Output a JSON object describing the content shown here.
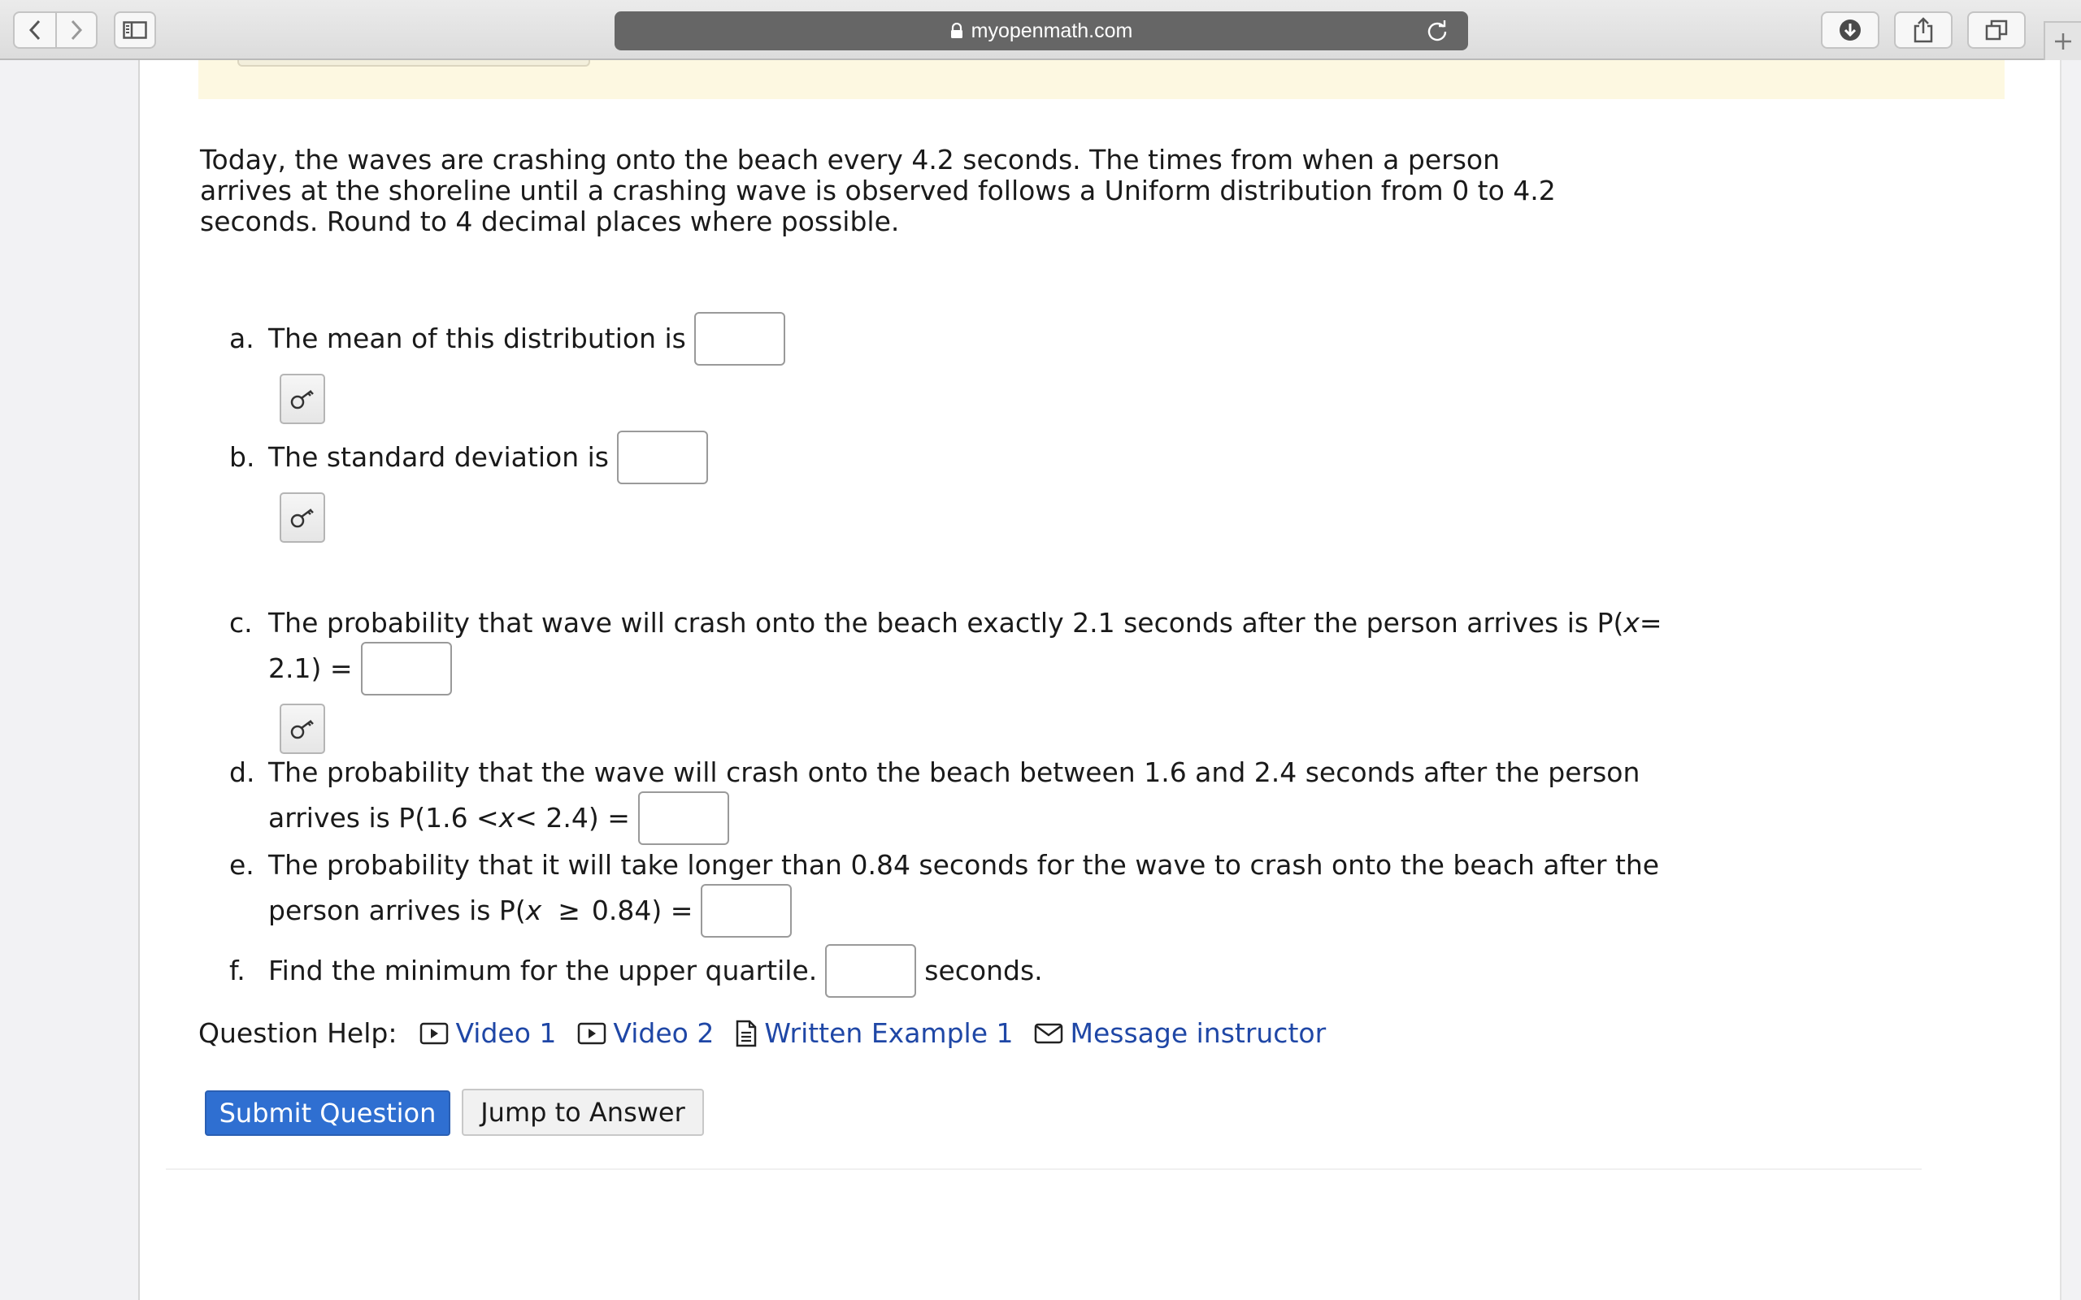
{
  "browser": {
    "url": "myopenmath.com"
  },
  "prompt": "Today, the waves are crashing onto the beach every 4.2 seconds. The times from when a person arrives at the shoreline until a crashing wave is observed follows a Uniform distribution from 0 to 4.2 seconds. Round to 4 decimal places where possible.",
  "questions": {
    "a": {
      "letter": "a.",
      "text": "The mean of this distribution is"
    },
    "b": {
      "letter": "b.",
      "text": "The standard deviation is"
    },
    "c": {
      "letter": "c.",
      "line1_pre": "The probability that wave will crash onto the beach exactly 2.1 seconds after the person arrives is P(",
      "var": "x",
      "line1_post": " =",
      "line2": "2.1) ="
    },
    "d": {
      "letter": "d.",
      "line1": "The probability that the wave will crash onto the beach between 1.6 and 2.4 seconds after the person",
      "line2_pre": "arrives is P(1.6 < ",
      "var": "x",
      "line2_post": " < 2.4) ="
    },
    "e": {
      "letter": "e.",
      "line1": "The probability that it will take longer than 0.84 seconds for the wave to crash onto the beach after the",
      "line2_pre": "person arrives is P(",
      "var": "x",
      "symbol": "≥",
      "line2_post": "0.84) ="
    },
    "f": {
      "letter": "f.",
      "text": "Find the minimum for the upper quartile.",
      "suffix": "seconds."
    }
  },
  "help": {
    "label": "Question Help:",
    "links": [
      {
        "label": "Video 1",
        "icon": "play-icon"
      },
      {
        "label": "Video 2",
        "icon": "play-icon"
      },
      {
        "label": "Written Example 1",
        "icon": "document-icon"
      },
      {
        "label": "Message instructor",
        "icon": "envelope-icon"
      }
    ]
  },
  "buttons": {
    "submit": "Submit Question",
    "jump": "Jump to Answer"
  },
  "colors": {
    "link": "#1f47a6",
    "primary": "#2f6fd1",
    "notice": "#fdf8e1"
  }
}
